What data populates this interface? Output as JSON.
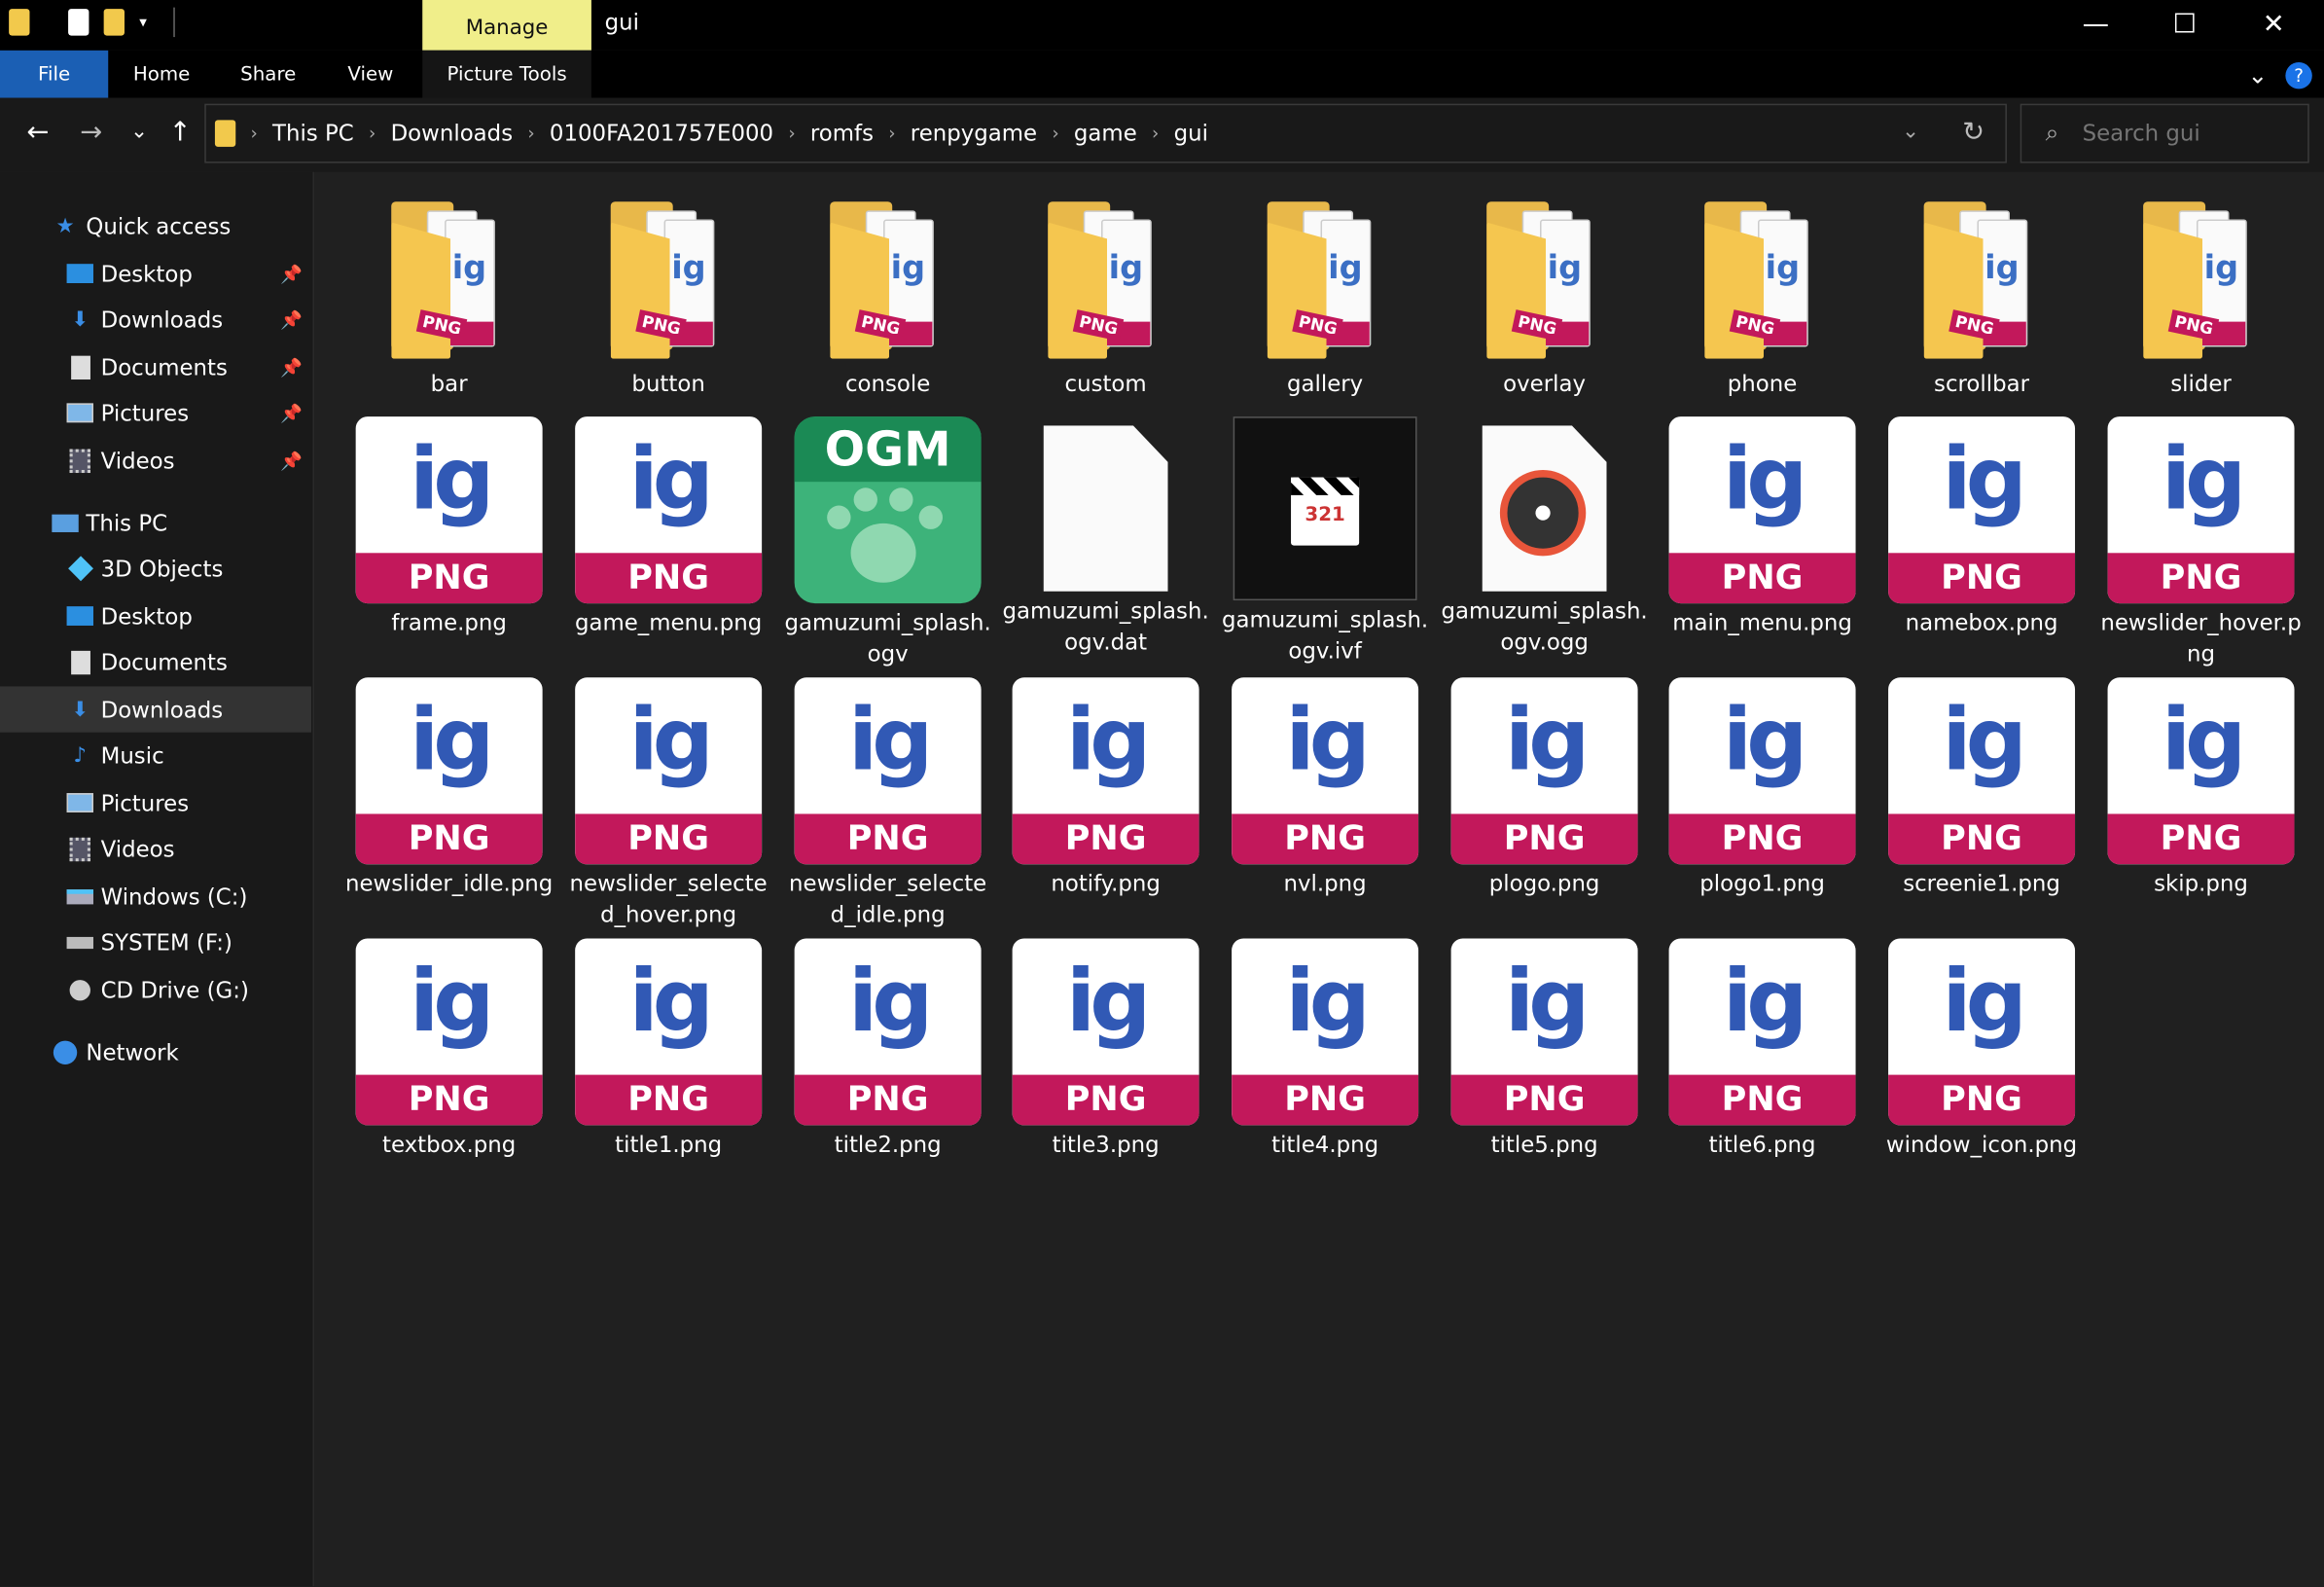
{
  "window": {
    "title": "gui",
    "context_tab": "Manage",
    "minimize": "—",
    "maximize": "☐",
    "close": "✕"
  },
  "ribbon": {
    "tabs": [
      "File",
      "Home",
      "Share",
      "View"
    ],
    "context_tab": "Picture Tools",
    "help": "?"
  },
  "nav": {
    "back": "←",
    "forward": "→",
    "recent": "⌄",
    "up": "↑",
    "breadcrumbs": [
      "This PC",
      "Downloads",
      "0100FA201757E000",
      "romfs",
      "renpygame",
      "game",
      "gui"
    ],
    "search_placeholder": "Search gui"
  },
  "sidebar": {
    "quick_access": "Quick access",
    "quick_items": [
      "Desktop",
      "Downloads",
      "Documents",
      "Pictures",
      "Videos"
    ],
    "this_pc": "This PC",
    "pc_items": [
      "3D Objects",
      "Desktop",
      "Documents",
      "Downloads",
      "Music",
      "Pictures",
      "Videos",
      "Windows (C:)",
      "SYSTEM (F:)",
      "CD Drive (G:)"
    ],
    "network": "Network",
    "selected": "Downloads"
  },
  "folders": [
    "bar",
    "button",
    "console",
    "custom",
    "gallery",
    "overlay",
    "phone",
    "scrollbar",
    "slider"
  ],
  "files": [
    {
      "name": "frame.png",
      "kind": "png"
    },
    {
      "name": "game_menu.png",
      "kind": "png"
    },
    {
      "name": "gamuzumi_splash.ogv",
      "kind": "ogm"
    },
    {
      "name": "gamuzumi_splash.ogv.dat",
      "kind": "blank"
    },
    {
      "name": "gamuzumi_splash.ogv.ivf",
      "kind": "ivf"
    },
    {
      "name": "gamuzumi_splash.ogv.ogg",
      "kind": "ogg"
    },
    {
      "name": "main_menu.png",
      "kind": "png"
    },
    {
      "name": "namebox.png",
      "kind": "png"
    },
    {
      "name": "newslider_hover.png",
      "kind": "png"
    },
    {
      "name": "newslider_idle.png",
      "kind": "png"
    },
    {
      "name": "newslider_selected_hover.png",
      "kind": "png"
    },
    {
      "name": "newslider_selected_idle.png",
      "kind": "png"
    },
    {
      "name": "notify.png",
      "kind": "png"
    },
    {
      "name": "nvl.png",
      "kind": "png"
    },
    {
      "name": "plogo.png",
      "kind": "png"
    },
    {
      "name": "plogo1.png",
      "kind": "png"
    },
    {
      "name": "screenie1.png",
      "kind": "png"
    },
    {
      "name": "skip.png",
      "kind": "png"
    },
    {
      "name": "textbox.png",
      "kind": "png"
    },
    {
      "name": "title1.png",
      "kind": "png"
    },
    {
      "name": "title2.png",
      "kind": "png"
    },
    {
      "name": "title3.png",
      "kind": "png"
    },
    {
      "name": "title4.png",
      "kind": "png"
    },
    {
      "name": "title5.png",
      "kind": "png"
    },
    {
      "name": "title6.png",
      "kind": "png"
    },
    {
      "name": "window_icon.png",
      "kind": "png"
    }
  ],
  "icons": {
    "png_badge": "PNG",
    "ig_glyph": "ig",
    "ogm_badge": "OGM",
    "clapper_number": "321",
    "folder_badge": "PNG"
  },
  "colors": {
    "accent": "#1b5fb4",
    "manage_tab": "#f0ee8a",
    "png_band": "#c2185b",
    "folder": "#f5c64f",
    "ogm": "#3db37a"
  }
}
